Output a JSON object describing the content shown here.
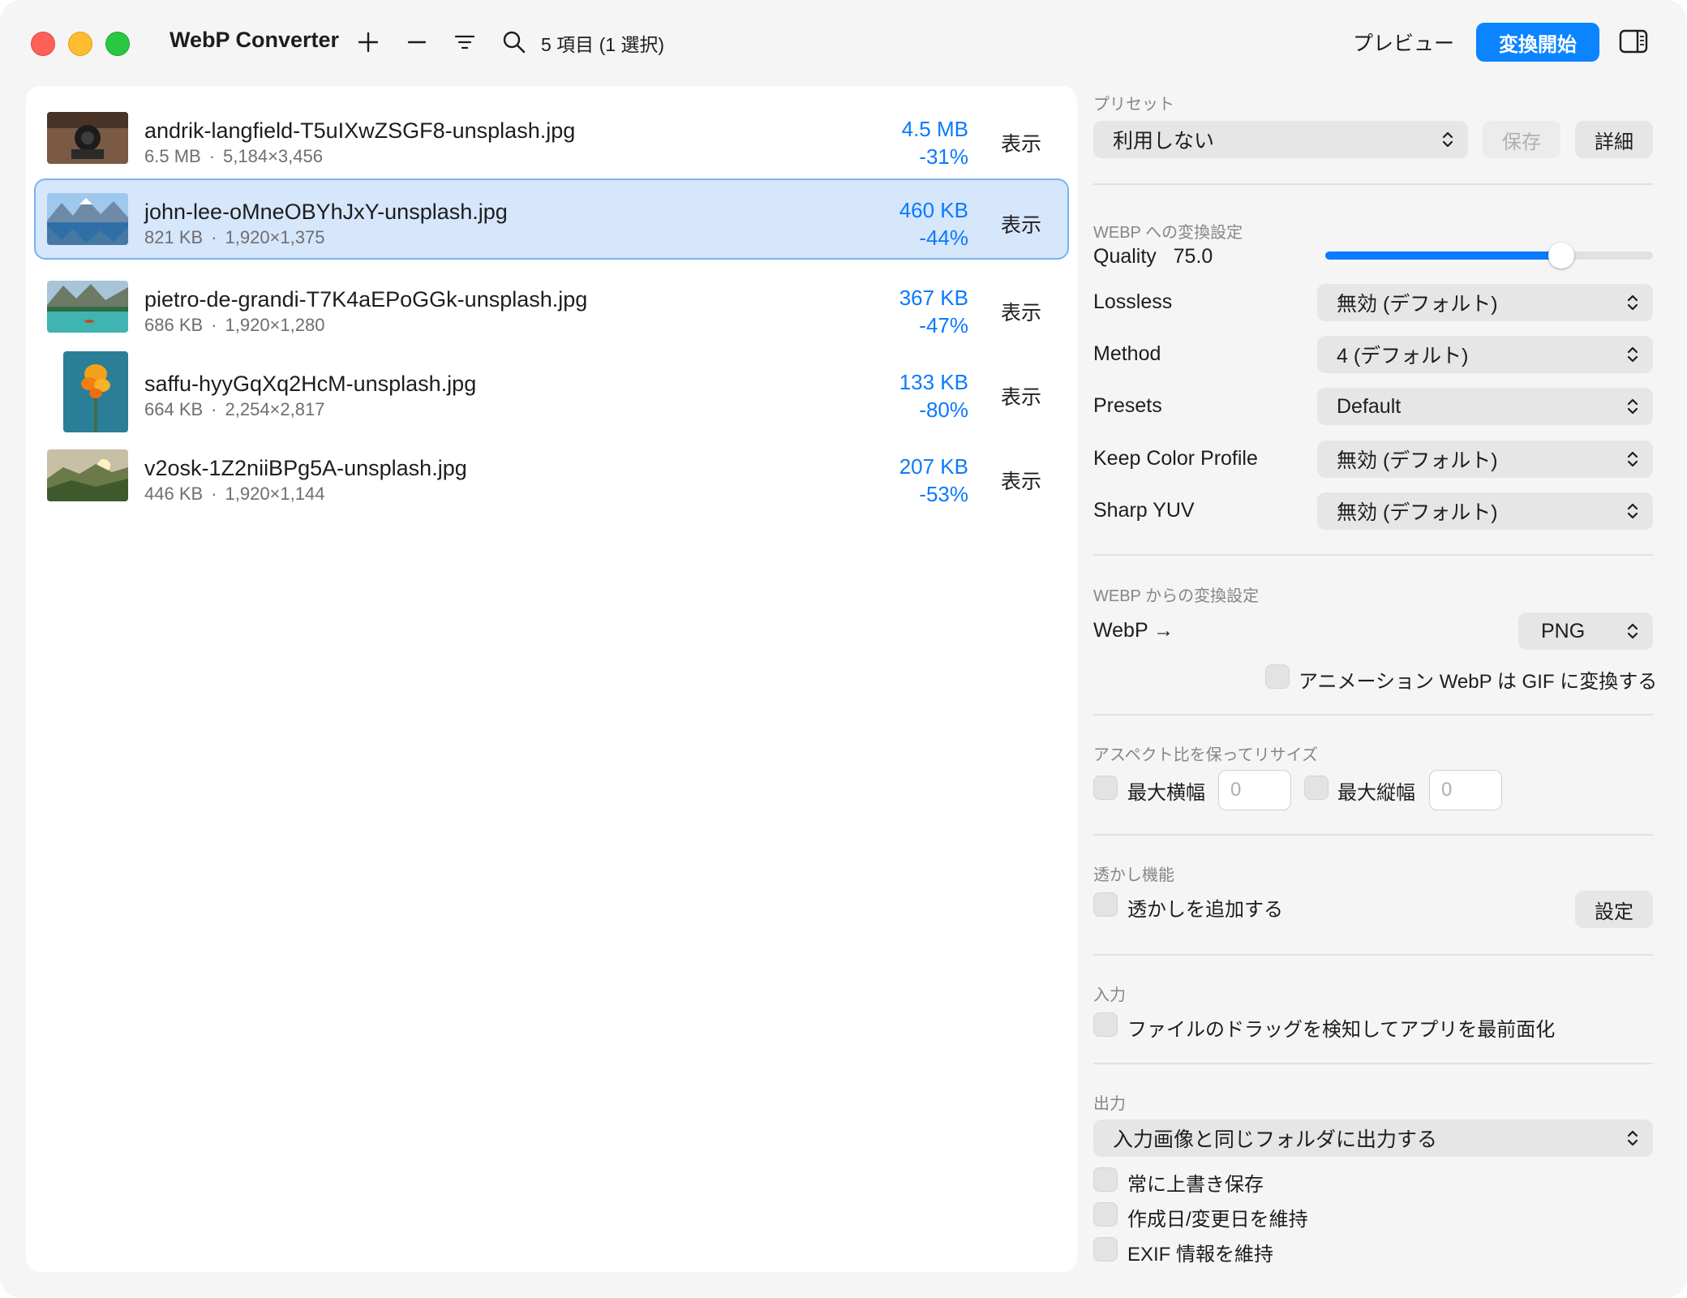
{
  "window": {
    "title": "WebP Converter",
    "selection_status": "5 項目 (1 選択)",
    "preview_label": "プレビュー",
    "start_label": "変換開始",
    "toolbar_icons": [
      "plus-icon",
      "minus-icon",
      "filter-icon",
      "search-icon",
      "sidebar-icon"
    ]
  },
  "files": [
    {
      "name": "andrik-langfield-T5uIXwZSGF8-unsplash.jpg",
      "orig_size": "6.5 MB",
      "dims": "5,184×3,456",
      "new_size": "4.5 MB",
      "pct": "-31%",
      "show": "表示",
      "selected": false
    },
    {
      "name": "john-lee-oMneOBYhJxY-unsplash.jpg",
      "orig_size": "821 KB",
      "dims": "1,920×1,375",
      "new_size": "460 KB",
      "pct": "-44%",
      "show": "表示",
      "selected": true
    },
    {
      "name": "pietro-de-grandi-T7K4aEPoGGk-unsplash.jpg",
      "orig_size": "686 KB",
      "dims": "1,920×1,280",
      "new_size": "367 KB",
      "pct": "-47%",
      "show": "表示",
      "selected": false
    },
    {
      "name": "saffu-hyyGqXq2HcM-unsplash.jpg",
      "orig_size": "664 KB",
      "dims": "2,254×2,817",
      "new_size": "133 KB",
      "pct": "-80%",
      "show": "表示",
      "selected": false
    },
    {
      "name": "v2osk-1Z2niiBPg5A-unsplash.jpg",
      "orig_size": "446 KB",
      "dims": "1,920×1,144",
      "new_size": "207 KB",
      "pct": "-53%",
      "show": "表示",
      "selected": false
    }
  ],
  "settings": {
    "preset": {
      "section": "プリセット",
      "value": "利用しない",
      "save": "保存",
      "details": "詳細"
    },
    "to_webp": {
      "section": "WEBP への変換設定",
      "quality_label": "Quality",
      "quality_value": "75.0",
      "quality_fraction": 0.72,
      "lossless_label": "Lossless",
      "lossless_value": "無効 (デフォルト)",
      "method_label": "Method",
      "method_value": "4 (デフォルト)",
      "presets_label": "Presets",
      "presets_value": "Default",
      "color_profile_label": "Keep Color Profile",
      "color_profile_value": "無効 (デフォルト)",
      "sharp_yuv_label": "Sharp YUV",
      "sharp_yuv_value": "無効 (デフォルト)"
    },
    "from_webp": {
      "section": "WEBP からの変換設定",
      "label": "WebP →",
      "format": "PNG",
      "gif_option": "アニメーション WebP は GIF に変換する"
    },
    "resize": {
      "section": "アスペクト比を保ってリサイズ",
      "max_width_label": "最大横幅",
      "max_width_placeholder": "0",
      "max_height_label": "最大縦幅",
      "max_height_placeholder": "0"
    },
    "watermark": {
      "section": "透かし機能",
      "option": "透かしを追加する",
      "settings": "設定"
    },
    "input": {
      "section": "入力",
      "option": "ファイルのドラッグを検知してアプリを最前面化"
    },
    "output": {
      "section": "出力",
      "destination": "入力画像と同じフォルダに出力する",
      "overwrite": "常に上書き保存",
      "keep_dates": "作成日/変更日を維持",
      "keep_exif": "EXIF 情報を維持"
    }
  },
  "colors": {
    "accent": "#0a84ff",
    "selection_bg": "#d6e6fb"
  }
}
